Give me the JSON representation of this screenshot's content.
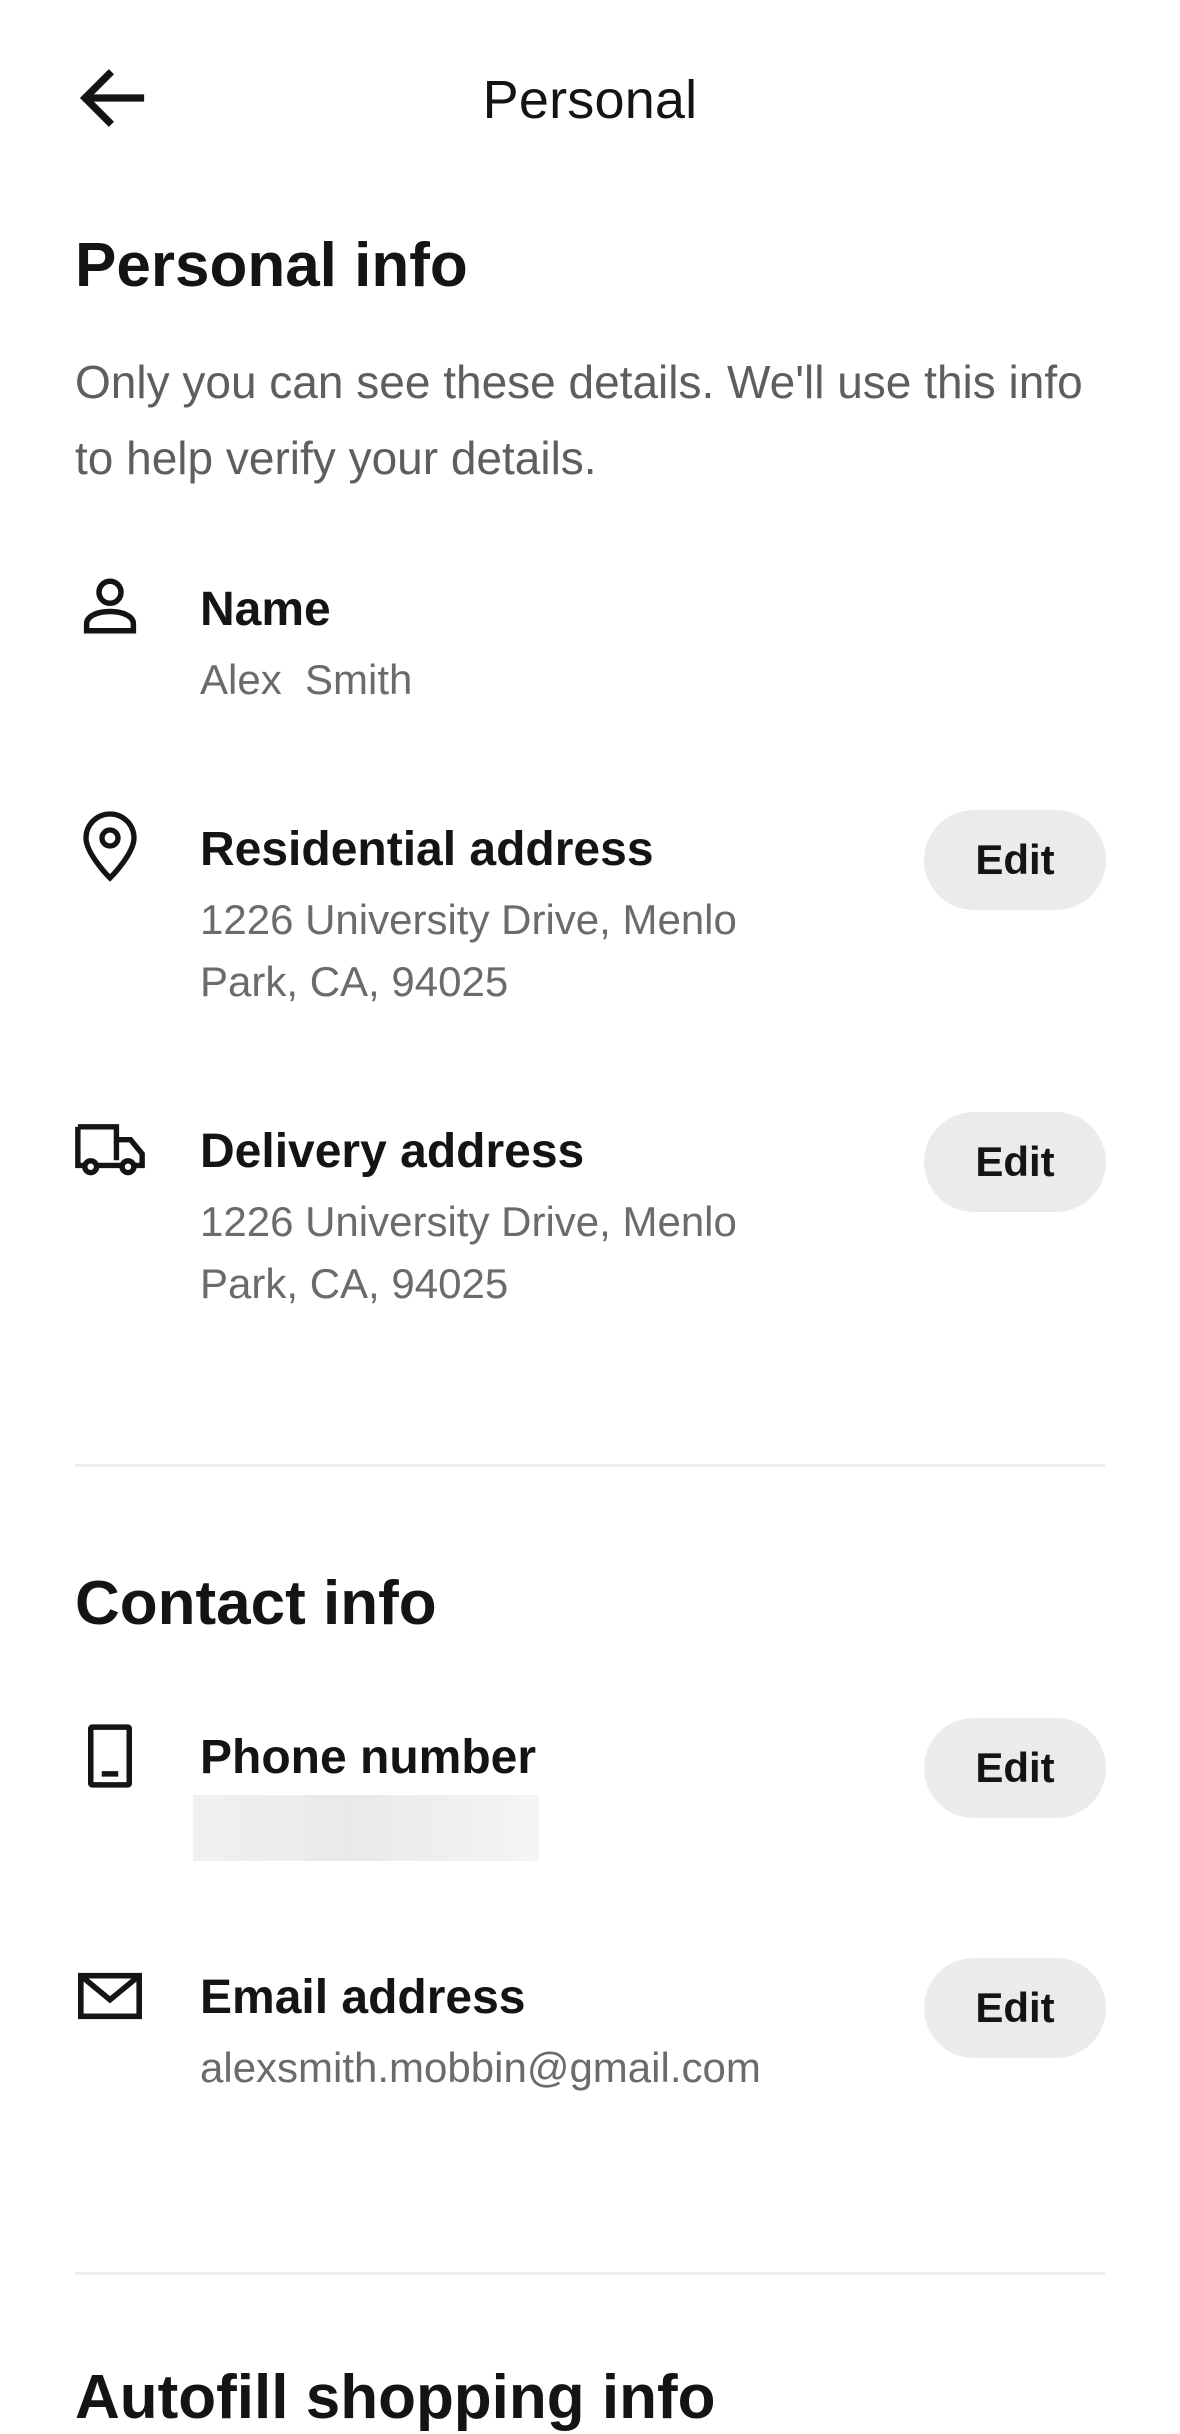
{
  "header": {
    "title": "Personal",
    "back_icon": "arrow-left-icon"
  },
  "personal_info": {
    "title": "Personal info",
    "description": "Only you can see these details. We'll use this info to help verify your details.",
    "name": {
      "icon": "person-icon",
      "label": "Name",
      "value": "Alex  Smith"
    },
    "residential_address": {
      "icon": "location-pin-icon",
      "label": "Residential address",
      "value": "1226 University Drive, Menlo Park, CA, 94025",
      "edit_label": "Edit"
    },
    "delivery_address": {
      "icon": "delivery-truck-icon",
      "label": "Delivery address",
      "value": "1226 University Drive, Menlo Park, CA, 94025",
      "edit_label": "Edit"
    }
  },
  "contact_info": {
    "title": "Contact info",
    "phone": {
      "icon": "phone-icon",
      "label": "Phone number",
      "edit_label": "Edit"
    },
    "email": {
      "icon": "mail-icon",
      "label": "Email address",
      "value": "alexsmith.mobbin@gmail.com",
      "edit_label": "Edit"
    }
  },
  "next_section": {
    "title_partial": "Autofill shopping info"
  },
  "colors": {
    "text_primary": "#141414",
    "text_secondary": "#6b6b6b",
    "button_bg": "#ebebeb",
    "divider": "#eeeeee"
  }
}
